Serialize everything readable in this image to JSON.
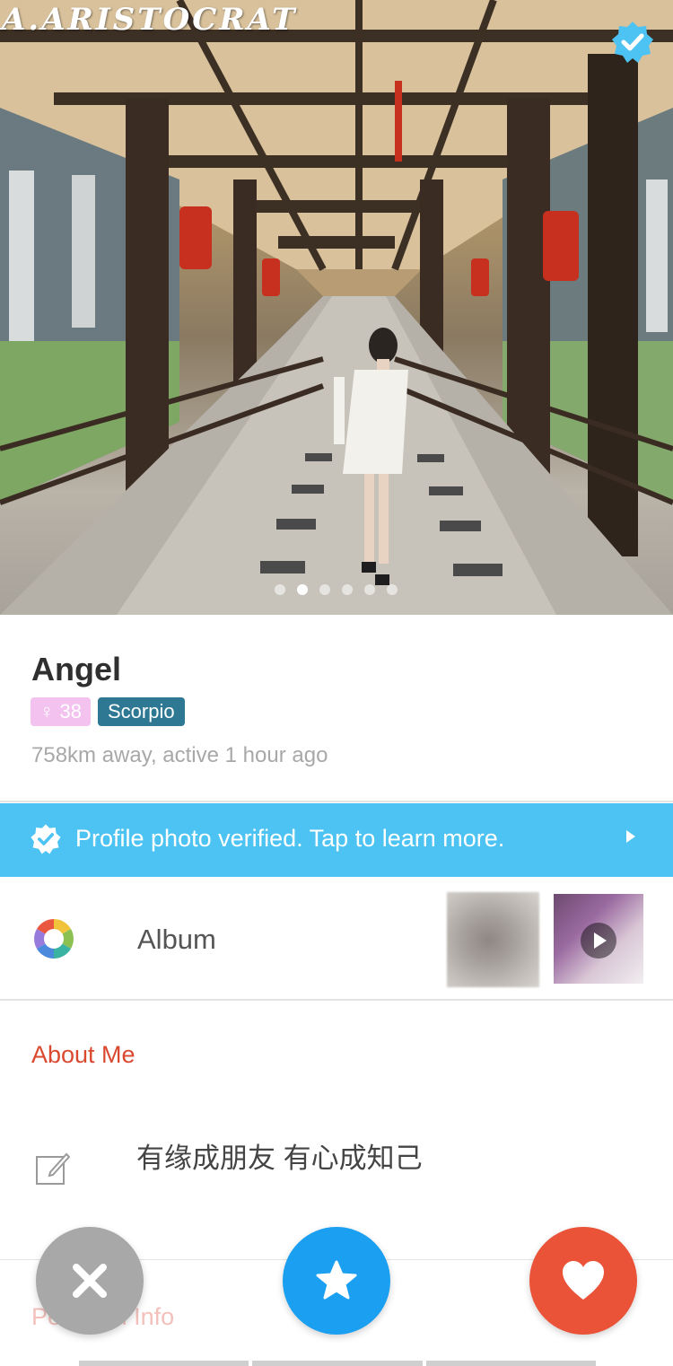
{
  "hero": {
    "watermark": "A.ARISTOCRAT",
    "dot_count": 6,
    "active_dot": 1
  },
  "profile": {
    "name": "Angel",
    "gender_symbol": "♀",
    "age": "38",
    "zodiac": "Scorpio",
    "distance_text": "758km away, active 1 hour ago"
  },
  "banner": {
    "text": "Profile photo verified. Tap to learn more."
  },
  "album": {
    "label": "Album"
  },
  "about": {
    "title": "About Me",
    "text": "有缘成朋友 有心成知己"
  },
  "personal": {
    "title": "Personal Info"
  },
  "colors": {
    "verified_blue": "#4cc3f2",
    "about_red": "#d9482f",
    "pass_grey": "#a8a8a8",
    "star_blue": "#1b9ff0",
    "like_red": "#ea5338",
    "age_pink": "#f3c2ef",
    "zodiac_teal": "#2e7894"
  },
  "icons": {
    "verified": "verified-check-icon",
    "album": "color-wheel-icon",
    "edit": "edit-note-icon",
    "pass": "close-icon",
    "star": "star-icon",
    "like": "heart-icon"
  }
}
